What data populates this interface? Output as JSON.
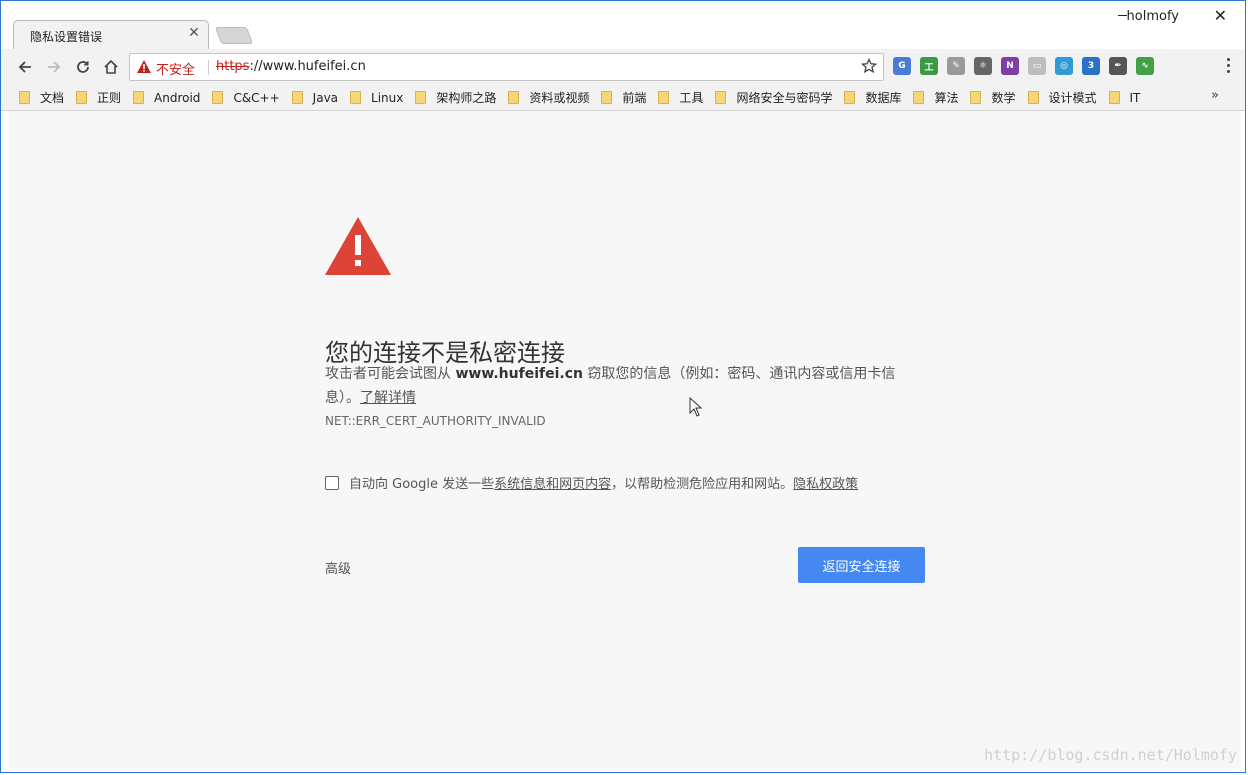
{
  "window": {
    "tab_title": "隐私设置错误",
    "profile_name": "holmofy"
  },
  "toolbar": {
    "security_label": "不安全",
    "url_scheme": "https",
    "url_rest": "://www.hufeifei.cn",
    "extensions": [
      {
        "icon": "translate-icon",
        "color": "#4a7bd6",
        "glyph": "G"
      },
      {
        "icon": "tools-icon",
        "color": "#3c9a45",
        "glyph": "工"
      },
      {
        "icon": "pen-icon",
        "color": "#9a9a9a",
        "glyph": "✎"
      },
      {
        "icon": "molecule-icon",
        "color": "#666666",
        "glyph": "⚛"
      },
      {
        "icon": "onenote-icon",
        "color": "#7b3fa6",
        "glyph": "N"
      },
      {
        "icon": "clipboard-icon",
        "color": "#bdbdbd",
        "glyph": "▭"
      },
      {
        "icon": "speed-icon",
        "color": "#2e9ad6",
        "glyph": "◎"
      },
      {
        "icon": "css3-icon",
        "color": "#2a71c9",
        "glyph": "3"
      },
      {
        "icon": "eyedropper-icon",
        "color": "#555555",
        "glyph": "✒"
      },
      {
        "icon": "pulse-icon",
        "color": "#43a047",
        "glyph": "∿"
      }
    ]
  },
  "bookmarks": [
    "文档",
    "正则",
    "Android",
    "C&C++",
    "Java",
    "Linux",
    "架构师之路",
    "资料或视频",
    "前端",
    "工具",
    "网络安全与密码学",
    "数据库",
    "算法",
    "数学",
    "设计模式",
    "IT"
  ],
  "bookmarks_more": "»",
  "page": {
    "heading": "您的连接不是私密连接",
    "desc_pre": "攻击者可能会试图从 ",
    "desc_host": "www.hufeifei.cn",
    "desc_post": " 窃取您的信息（例如：密码、通讯内容或信用卡信息）。",
    "learn_more": "了解详情",
    "error_code": "NET::ERR_CERT_AUTHORITY_INVALID",
    "optin_pre": "自动向 Google 发送一些",
    "optin_link": "系统信息和网页内容",
    "optin_mid": "，以帮助检测危险应用和网站。",
    "optin_privacy": "隐私权政策",
    "advanced_label": "高级",
    "back_button": "返回安全连接"
  },
  "watermark": "http://blog.csdn.net/Holmofy",
  "colors": {
    "danger": "#db4437",
    "primary_button": "#4688f1"
  }
}
